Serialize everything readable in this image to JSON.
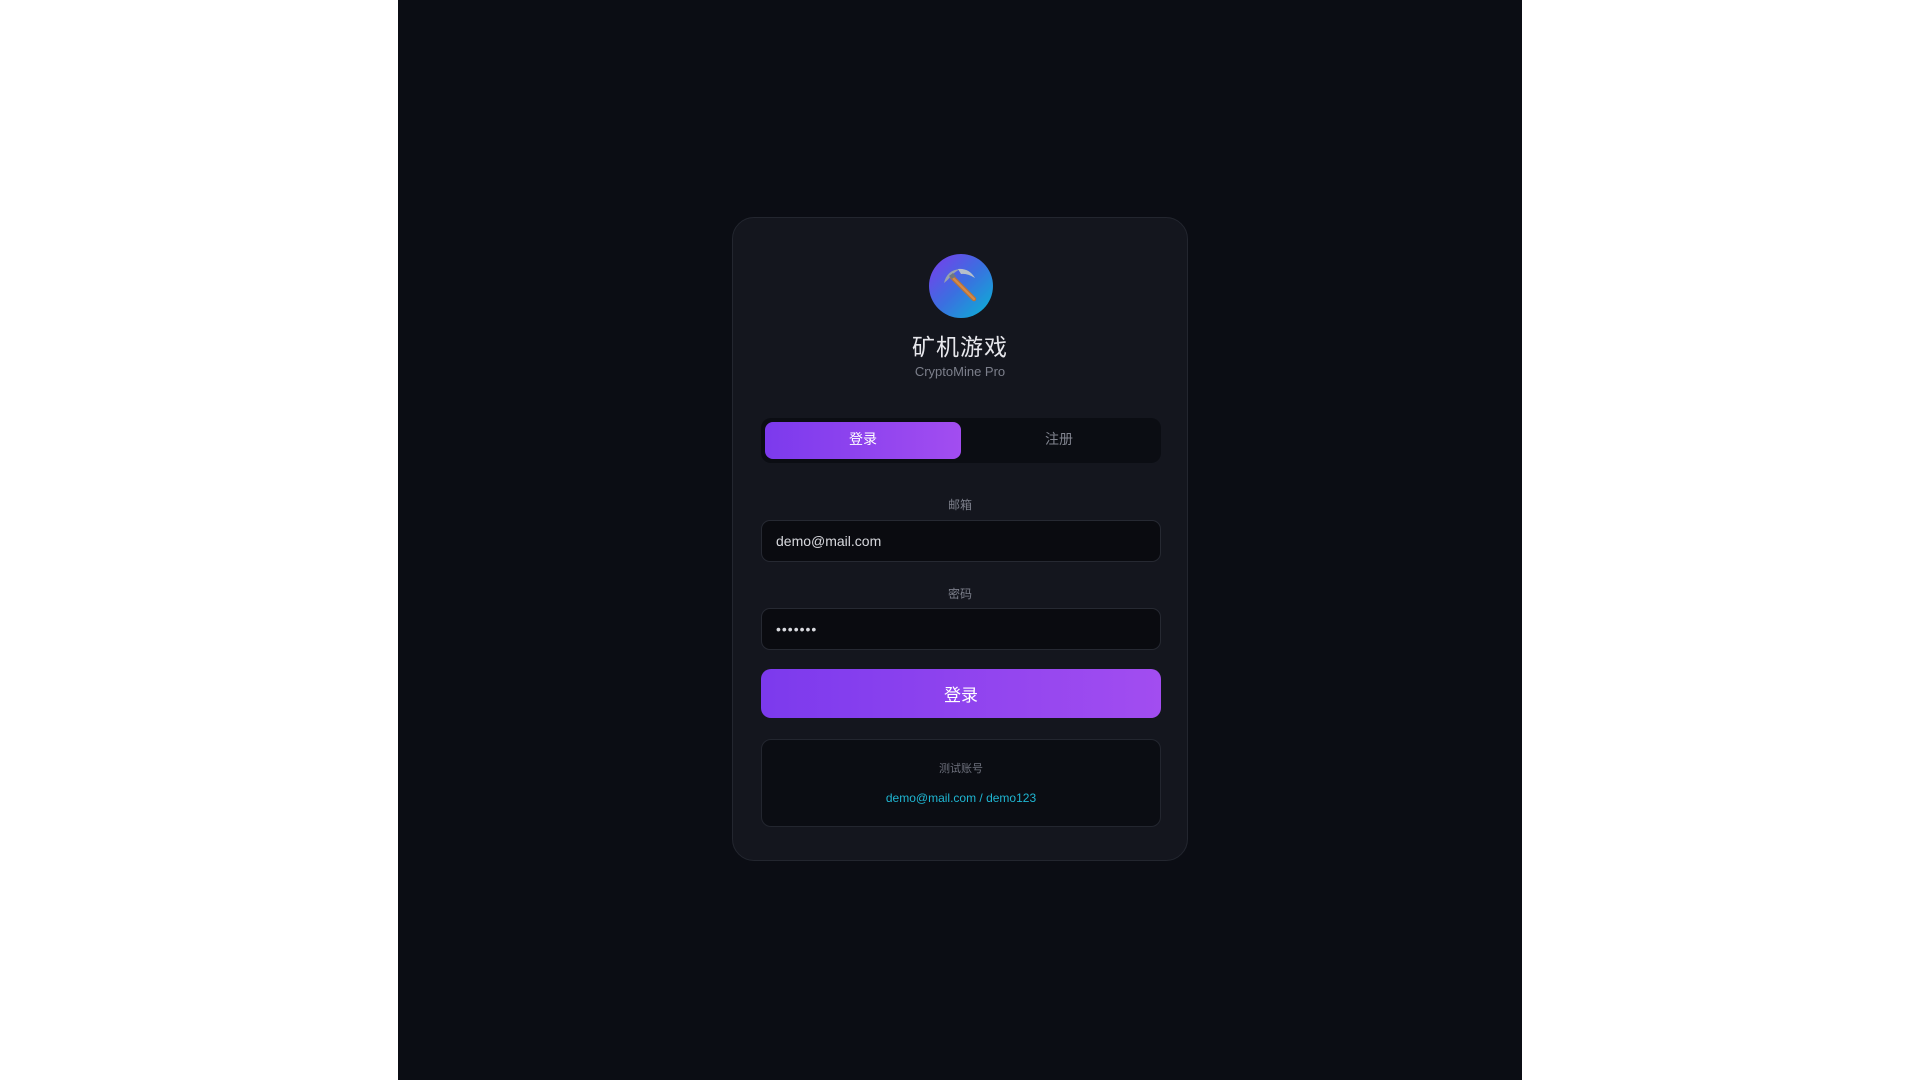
{
  "app": {
    "title": "矿机游戏",
    "subtitle": "CryptoMine Pro",
    "logo_icon": "pickaxe-icon"
  },
  "tabs": [
    {
      "label": "登录",
      "active": true
    },
    {
      "label": "注册",
      "active": false
    }
  ],
  "form": {
    "email_label": "邮箱",
    "email_value": "demo@mail.com",
    "password_label": "密码",
    "password_value": "demo123",
    "submit_label": "登录"
  },
  "demo": {
    "title": "测试账号",
    "credentials": "demo@mail.com / demo123"
  },
  "colors": {
    "background": "#0b0d14",
    "card": "#14161e",
    "accent_start": "#7c3aed",
    "accent_end": "#a24df0",
    "link": "#1fb6d2"
  }
}
